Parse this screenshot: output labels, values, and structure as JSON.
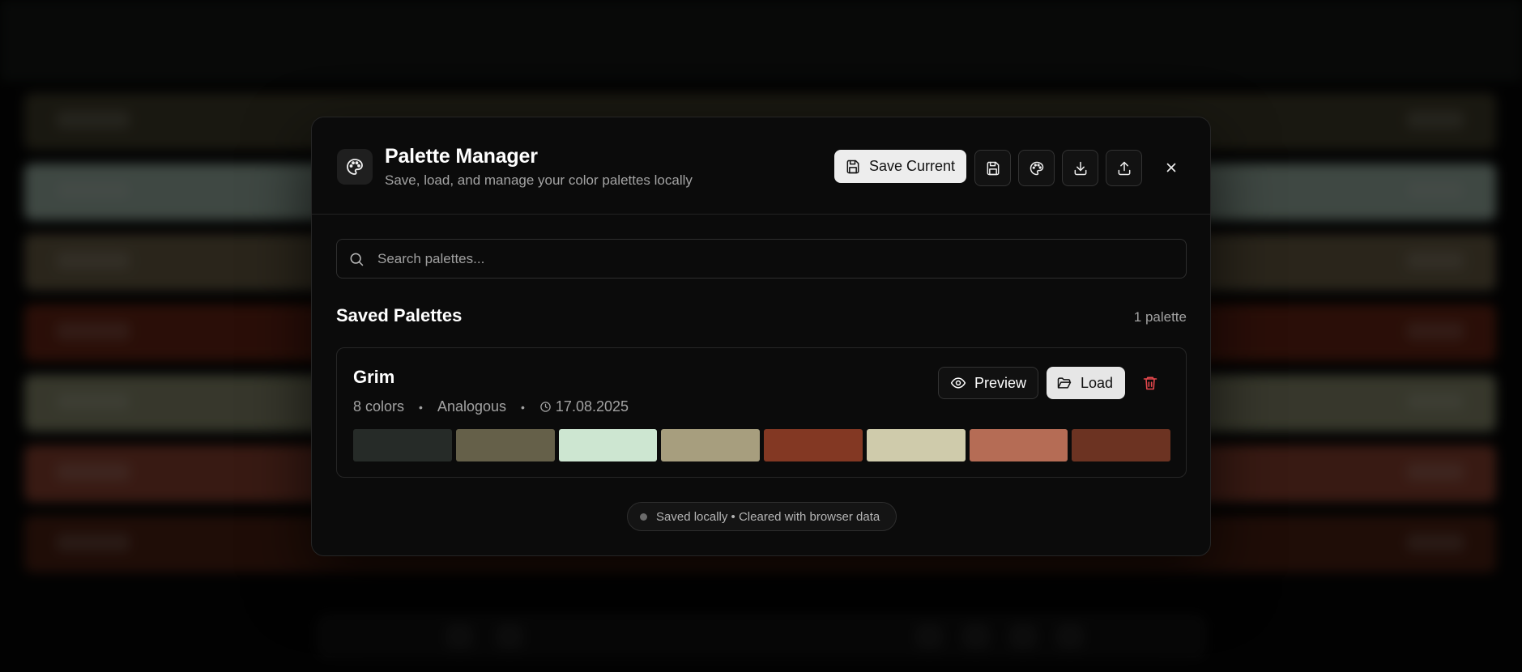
{
  "modal": {
    "title": "Palette Manager",
    "subtitle": "Save, load, and manage your color palettes locally",
    "save_current_label": "Save Current",
    "header_icons": [
      "palette-icon",
      "save-icon",
      "palette-icon",
      "download-icon",
      "upload-icon",
      "close-icon"
    ]
  },
  "search": {
    "placeholder": "Search palettes...",
    "value": ""
  },
  "saved": {
    "heading": "Saved Palettes",
    "count": "1 palette"
  },
  "palettes": [
    {
      "name": "Grim",
      "colors_label": "8 colors",
      "scheme": "Analogous",
      "date": "17.08.2025",
      "preview_label": "Preview",
      "load_label": "Load",
      "swatches": [
        "#262b28",
        "#656049",
        "#cde6d1",
        "#a79e7e",
        "#833823",
        "#cfcbab",
        "#b56c55",
        "#6c3322"
      ]
    }
  ],
  "status": {
    "text": "Saved locally • Cleared with browser data"
  },
  "colors": {
    "modal_bg": "#0b0b0b",
    "border": "#262626",
    "delete": "#e5484d",
    "primary_button": "#ededed"
  },
  "background_rows": [
    "#1a1f1c",
    "#4a4630",
    "#b7d1c2",
    "#7a6c4f",
    "#7a2a16",
    "#9fa17e",
    "#a44c37",
    "#5a2514"
  ]
}
